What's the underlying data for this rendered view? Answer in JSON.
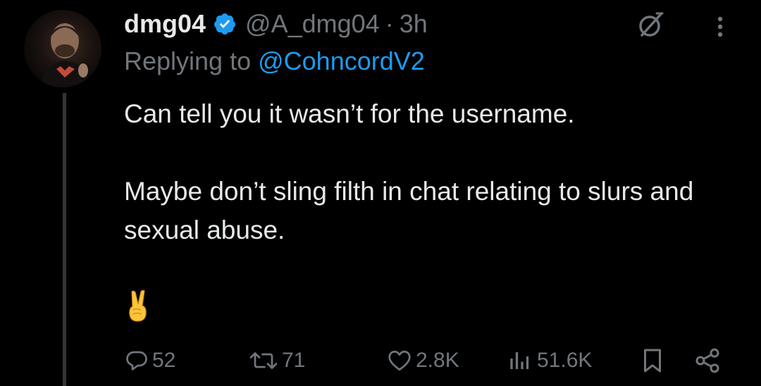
{
  "tweet": {
    "author": {
      "display_name": "dmg04",
      "handle": "@A_dmg04",
      "verified": true,
      "avatar_icon": "avatar"
    },
    "separator": "·",
    "time": "3h",
    "replying": {
      "prefix": "Replying to ",
      "mention": "@CohncordV2"
    },
    "paragraphs": [
      "Can tell you it wasn’t for the username.",
      "Maybe don’t sling filth in chat relating to slurs and sexual abuse."
    ],
    "emoji": "victory-hand-icon",
    "actions": {
      "replies": "52",
      "retweets": "71",
      "likes": "2.8K",
      "views": "51.6K"
    }
  },
  "colors": {
    "background": "#000000",
    "primary_text": "#e7e9ea",
    "secondary_text": "#71767b",
    "link": "#1d9bf0",
    "verified": "#1d9bf0",
    "thread_line": "#333639"
  }
}
